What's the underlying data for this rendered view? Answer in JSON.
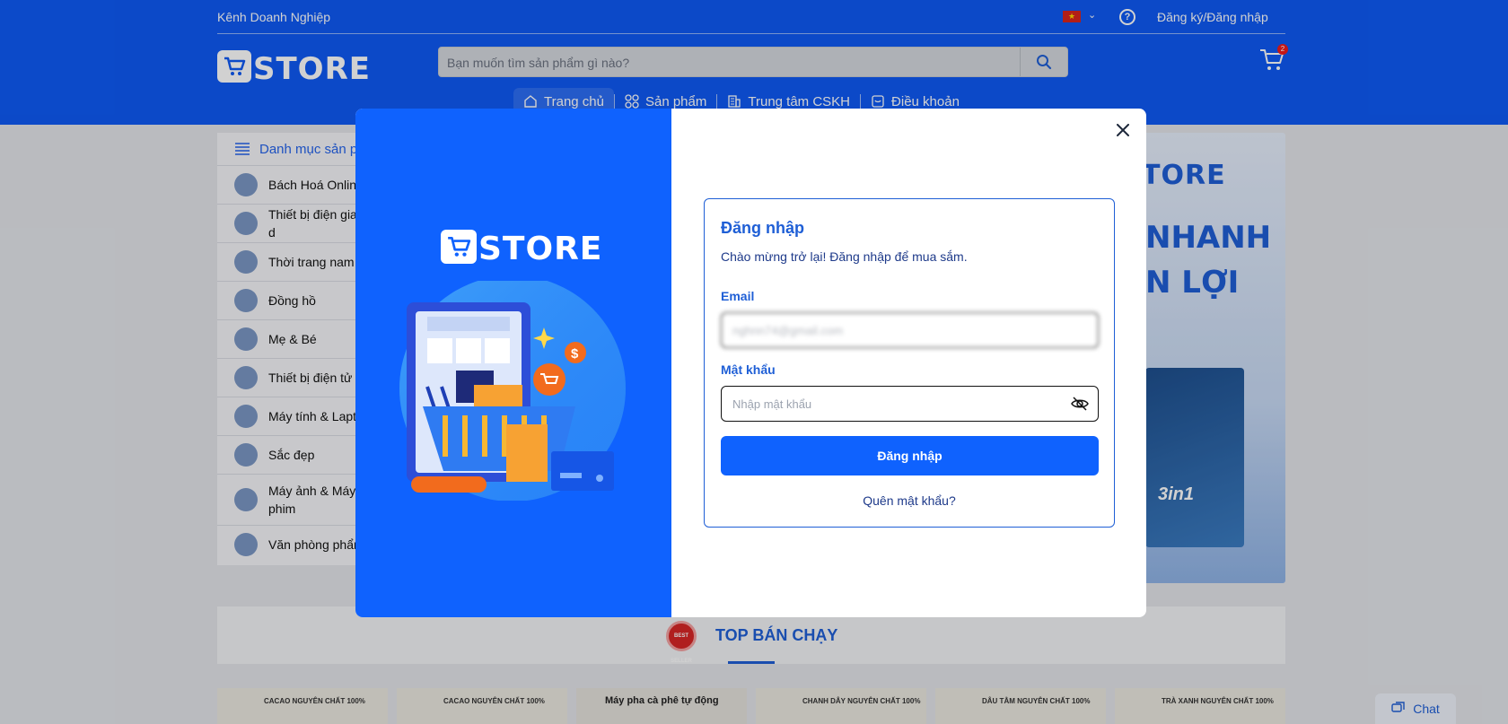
{
  "header": {
    "business_channel": "Kênh Doanh Nghiệp",
    "language_flag": "vietnam-flag-icon",
    "login_register": "Đăng ký/Đăng nhập",
    "logo_text": "STORE",
    "search_placeholder": "Bạn muốn tìm sản phẩm gì nào?",
    "cart_count": "2",
    "nav": [
      {
        "label": "Trang chủ",
        "icon": "home-icon"
      },
      {
        "label": "Sản phẩm",
        "icon": "grid-icon"
      },
      {
        "label": "Trung tâm CSKH",
        "icon": "building-icon"
      },
      {
        "label": "Điều khoản",
        "icon": "document-icon"
      }
    ]
  },
  "sidebar": {
    "title": "Danh mục sản ph",
    "items": [
      {
        "label": "Bách Hoá Online"
      },
      {
        "label": "Thiết bị điện gia d"
      },
      {
        "label": "Thời trang nam &"
      },
      {
        "label": "Đồng hồ"
      },
      {
        "label": "Mẹ & Bé"
      },
      {
        "label": "Thiết bị điện tử"
      },
      {
        "label": "Máy tính & Lapto"
      },
      {
        "label": "Sắc đẹp"
      },
      {
        "label": "Máy ảnh & Máy q phim"
      },
      {
        "label": "Văn phòng phẩm"
      }
    ]
  },
  "banner": {
    "brand": "TORE",
    "line1": "NHANH",
    "line2": "N LỢI",
    "product": "3in1"
  },
  "best_sellers": {
    "title": "TOP BÁN CHẠY",
    "medal_text": "BEST SELLER"
  },
  "products": [
    {
      "label": "CACAO NGUYÊN CHẤT 100%"
    },
    {
      "label": "CACAO NGUYÊN CHẤT 100%"
    },
    {
      "label": "Máy pha cà phê tự động"
    },
    {
      "label": "CHANH DÂY NGUYÊN CHẤT 100%"
    },
    {
      "label": "DÂU TẰM NGUYÊN CHẤT 100%"
    },
    {
      "label": "TRÀ XANH NGUYÊN CHẤT 100%"
    }
  ],
  "chat": {
    "label": "Chat"
  },
  "login_modal": {
    "logo_text": "STORE",
    "title": "Đăng nhập",
    "subtitle": "Chào mừng trở lại! Đăng nhập để mua sắm.",
    "email_label": "Email",
    "email_value": "nghnn74@gmail.com",
    "password_label": "Mật khẩu",
    "password_placeholder": "Nhập mật khẩu",
    "submit_label": "Đăng nhập",
    "forgot_label": "Quên mật khẩu?"
  },
  "colors": {
    "brand_blue": "#0f5af5",
    "modal_panel_blue": "#0f62fe",
    "heading_blue": "#1f5fd6",
    "badge_red": "#ef1b1b"
  }
}
